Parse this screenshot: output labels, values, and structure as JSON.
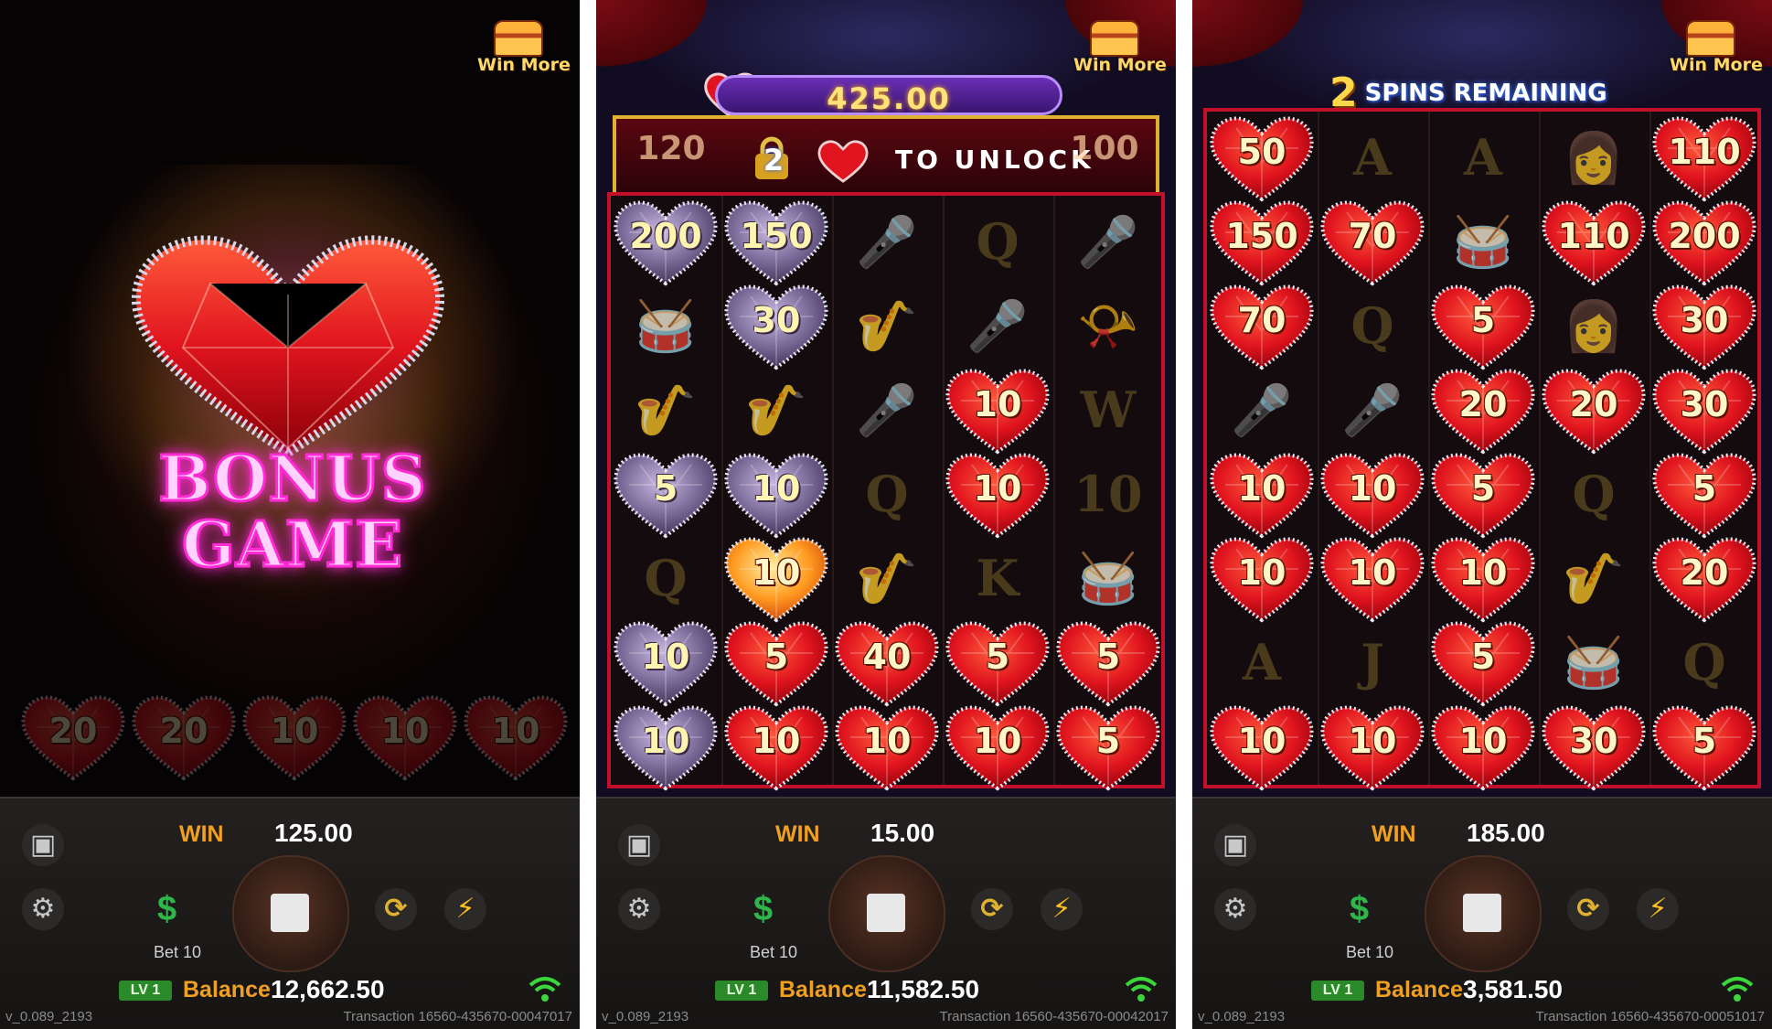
{
  "win_more_label": "Win More",
  "panels": [
    {
      "bonus_title": "BONUS",
      "bonus_subtitle": "GAME",
      "faded_hearts": [
        "20",
        "20",
        "10",
        "10",
        "10"
      ],
      "win_label": "WIN",
      "win_value": "125.00",
      "bet_label": "Bet 10",
      "level": "LV 1",
      "balance_label": "Balance",
      "balance_value": "12,662.50",
      "version": "v_0.089_2193",
      "transaction": "Transaction 16560-435670-00047017"
    },
    {
      "total_value": "425.00",
      "unlock_left": "120",
      "unlock_lock_num": "2",
      "unlock_text": "TO  UNLOCK",
      "unlock_right": "100",
      "grid": [
        [
          {
            "t": "silver",
            "v": "200"
          },
          {
            "t": "silver",
            "v": "150"
          },
          {
            "t": "sym",
            "v": "🎤"
          },
          {
            "t": "sym",
            "v": "Q"
          },
          {
            "t": "sym",
            "v": "🎤"
          }
        ],
        [
          {
            "t": "sym",
            "v": "🥁"
          },
          {
            "t": "silver",
            "v": "30"
          },
          {
            "t": "sym",
            "v": "🎷"
          },
          {
            "t": "sym",
            "v": "🎤"
          },
          {
            "t": "sym",
            "v": "📯"
          }
        ],
        [
          {
            "t": "sym",
            "v": "🎷"
          },
          {
            "t": "sym",
            "v": "🎷"
          },
          {
            "t": "sym",
            "v": "🎤"
          },
          {
            "t": "red",
            "v": "10"
          },
          {
            "t": "sym",
            "v": "W"
          }
        ],
        [
          {
            "t": "silver",
            "v": "5"
          },
          {
            "t": "silver",
            "v": "10"
          },
          {
            "t": "sym",
            "v": "Q"
          },
          {
            "t": "red",
            "v": "10"
          },
          {
            "t": "sym",
            "v": "10"
          }
        ],
        [
          {
            "t": "sym",
            "v": "Q"
          },
          {
            "t": "gold",
            "v": "10"
          },
          {
            "t": "sym",
            "v": "🎷"
          },
          {
            "t": "sym",
            "v": "K"
          },
          {
            "t": "sym",
            "v": "🥁"
          }
        ],
        [
          {
            "t": "silver",
            "v": "10"
          },
          {
            "t": "red",
            "v": "5"
          },
          {
            "t": "red",
            "v": "40"
          },
          {
            "t": "red",
            "v": "5"
          },
          {
            "t": "red",
            "v": "5"
          }
        ],
        [
          {
            "t": "silver",
            "v": "10"
          },
          {
            "t": "red",
            "v": "10"
          },
          {
            "t": "red",
            "v": "10"
          },
          {
            "t": "red",
            "v": "10"
          },
          {
            "t": "red",
            "v": "5"
          }
        ]
      ],
      "win_label": "WIN",
      "win_value": "15.00",
      "bet_label": "Bet 10",
      "level": "LV 1",
      "balance_label": "Balance",
      "balance_value": "11,582.50",
      "version": "v_0.089_2193",
      "transaction": "Transaction 16560-435670-00042017"
    },
    {
      "spins_num": "2",
      "spins_text": "SPINS REMAINING",
      "grid": [
        [
          {
            "t": "red",
            "v": "50"
          },
          {
            "t": "sym",
            "v": "A"
          },
          {
            "t": "sym",
            "v": "A"
          },
          {
            "t": "sym",
            "v": "👩"
          },
          {
            "t": "red",
            "v": "110"
          }
        ],
        [
          {
            "t": "red",
            "v": "150"
          },
          {
            "t": "red",
            "v": "70"
          },
          {
            "t": "sym",
            "v": "🥁"
          },
          {
            "t": "red",
            "v": "110"
          },
          {
            "t": "red",
            "v": "200"
          }
        ],
        [
          {
            "t": "red",
            "v": "70"
          },
          {
            "t": "sym",
            "v": "Q"
          },
          {
            "t": "red",
            "v": "5"
          },
          {
            "t": "sym",
            "v": "👩"
          },
          {
            "t": "red",
            "v": "30"
          }
        ],
        [
          {
            "t": "sym",
            "v": "🎤"
          },
          {
            "t": "sym",
            "v": "🎤"
          },
          {
            "t": "red",
            "v": "20"
          },
          {
            "t": "red",
            "v": "20"
          },
          {
            "t": "red",
            "v": "30"
          }
        ],
        [
          {
            "t": "red",
            "v": "10"
          },
          {
            "t": "red",
            "v": "10"
          },
          {
            "t": "red",
            "v": "5"
          },
          {
            "t": "sym",
            "v": "Q"
          },
          {
            "t": "red",
            "v": "5"
          }
        ],
        [
          {
            "t": "red",
            "v": "10"
          },
          {
            "t": "red",
            "v": "10"
          },
          {
            "t": "red",
            "v": "10"
          },
          {
            "t": "sym",
            "v": "🎷"
          },
          {
            "t": "red",
            "v": "20"
          }
        ],
        [
          {
            "t": "sym",
            "v": "A"
          },
          {
            "t": "sym",
            "v": "J"
          },
          {
            "t": "red",
            "v": "5"
          },
          {
            "t": "sym",
            "v": "🥁"
          },
          {
            "t": "sym",
            "v": "Q"
          }
        ],
        [
          {
            "t": "red",
            "v": "10"
          },
          {
            "t": "red",
            "v": "10"
          },
          {
            "t": "red",
            "v": "10"
          },
          {
            "t": "red",
            "v": "30"
          },
          {
            "t": "red",
            "v": "5"
          }
        ]
      ],
      "win_label": "WIN",
      "win_value": "185.00",
      "bet_label": "Bet 10",
      "level": "LV 1",
      "balance_label": "Balance",
      "balance_value": "3,581.50",
      "version": "v_0.089_2193",
      "transaction": "Transaction 16560-435670-00051017"
    }
  ],
  "colors": {
    "accent": "#f0a020",
    "heart_red": "#e0141e",
    "heart_silver": "#8a7aa0",
    "frame": "#c2102a",
    "win_green": "#2fb64a"
  },
  "icons": [
    "chest-icon",
    "briefcase-icon",
    "gear-icon",
    "dollar-icon",
    "stop-icon",
    "autoplay-icon",
    "turbo-icon",
    "wifi-icon",
    "lock-icon"
  ]
}
